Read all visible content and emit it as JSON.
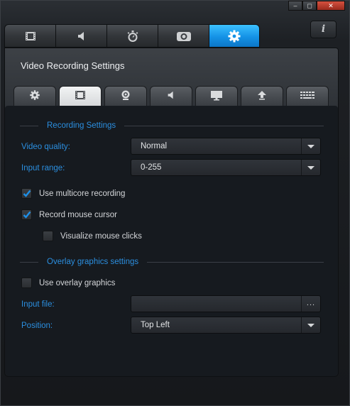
{
  "window": {
    "minimize": "–",
    "restore": "◻",
    "close": "✕"
  },
  "info_button": "i",
  "main_tabs": [
    {
      "icon": "film-icon"
    },
    {
      "icon": "speaker-icon"
    },
    {
      "icon": "stopwatch-icon"
    },
    {
      "icon": "camera-icon"
    },
    {
      "icon": "gear-icon",
      "active": true
    }
  ],
  "panel": {
    "title": "Video Recording Settings",
    "sub_tabs": [
      {
        "icon": "gear-icon"
      },
      {
        "icon": "film-icon",
        "active": true
      },
      {
        "icon": "webcam-icon"
      },
      {
        "icon": "speaker-icon"
      },
      {
        "icon": "monitor-icon"
      },
      {
        "icon": "upload-icon"
      },
      {
        "icon": "keyboard-icon"
      }
    ]
  },
  "recording_settings": {
    "section_title": "Recording Settings",
    "video_quality_label": "Video quality:",
    "video_quality_value": "Normal",
    "input_range_label": "Input range:",
    "input_range_value": "0-255",
    "multicore_label": "Use multicore recording",
    "multicore_checked": true,
    "mouse_cursor_label": "Record mouse cursor",
    "mouse_cursor_checked": true,
    "mouse_clicks_label": "Visualize mouse clicks",
    "mouse_clicks_checked": false
  },
  "overlay_settings": {
    "section_title": "Overlay graphics settings",
    "use_overlay_label": "Use overlay graphics",
    "use_overlay_checked": false,
    "input_file_label": "Input file:",
    "input_file_value": "",
    "browse_label": "...",
    "position_label": "Position:",
    "position_value": "Top Left"
  },
  "colors": {
    "accent": "#2b8fe0",
    "active_tab": "#1492e6",
    "check": "#1e8fe6"
  }
}
